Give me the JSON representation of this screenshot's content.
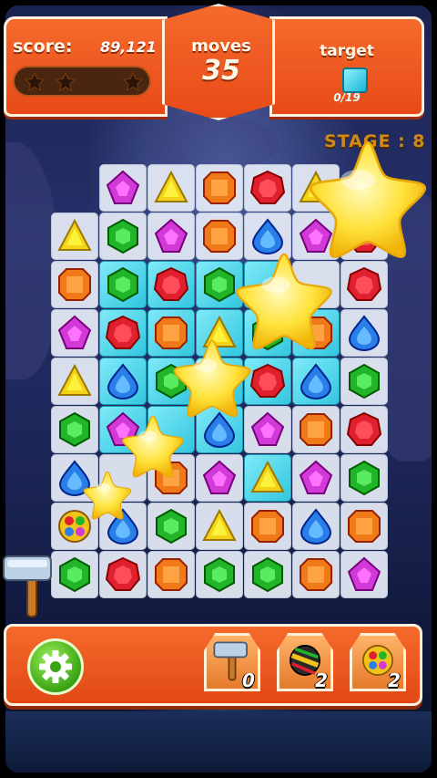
{
  "hud": {
    "score_label": "score:",
    "score_value": "89,121",
    "stars_earned": 3,
    "moves_label": "moves",
    "moves_value": "35",
    "target_label": "target",
    "target_gem": "cyan-square-gem",
    "target_count": "0/19",
    "stage_label": "STAGE : 8"
  },
  "colors": {
    "red": "#e0202e",
    "orange": "#f07a1a",
    "yellow": "#f5d21a",
    "green": "#22b52a",
    "blue": "#2a7ee8",
    "purple": "#d13ad6",
    "ice": "#33c6df",
    "hud_orange": "#e84a17"
  },
  "board": {
    "cols": 7,
    "rows": 9,
    "rows_data": [
      [
        "",
        "purple",
        "yellow",
        "orange",
        "red",
        "yellow",
        ""
      ],
      [
        "yellow",
        "green",
        "purple",
        "orange",
        "blue",
        "purple",
        "red"
      ],
      [
        "orange",
        "green",
        "red",
        "green",
        "",
        "",
        "red"
      ],
      [
        "purple",
        "red",
        "orange",
        "yellow",
        "green",
        "orange",
        "blue"
      ],
      [
        "yellow",
        "blue",
        "green",
        "",
        "red",
        "blue",
        "green"
      ],
      [
        "green",
        "purple",
        "",
        "blue",
        "purple",
        "orange",
        "red"
      ],
      [
        "blue",
        "",
        "orange",
        "purple",
        "yellow",
        "purple",
        "green"
      ],
      [
        "bomb",
        "blue",
        "green",
        "yellow",
        "orange",
        "blue",
        "orange"
      ],
      [
        "green",
        "red",
        "orange",
        "green",
        "green",
        "orange",
        "purple"
      ]
    ],
    "ice_cells": [
      [
        2,
        1
      ],
      [
        2,
        2
      ],
      [
        2,
        3
      ],
      [
        2,
        4
      ],
      [
        3,
        1
      ],
      [
        3,
        2
      ],
      [
        3,
        3
      ],
      [
        3,
        4
      ],
      [
        3,
        5
      ],
      [
        4,
        1
      ],
      [
        4,
        2
      ],
      [
        4,
        3
      ],
      [
        4,
        4
      ],
      [
        4,
        5
      ],
      [
        5,
        1
      ],
      [
        5,
        2
      ],
      [
        5,
        3
      ],
      [
        6,
        4
      ]
    ]
  },
  "boosters": [
    {
      "name": "hammer",
      "count": "0"
    },
    {
      "name": "striped-ball",
      "count": "2"
    },
    {
      "name": "color-bomb",
      "count": "2"
    }
  ]
}
